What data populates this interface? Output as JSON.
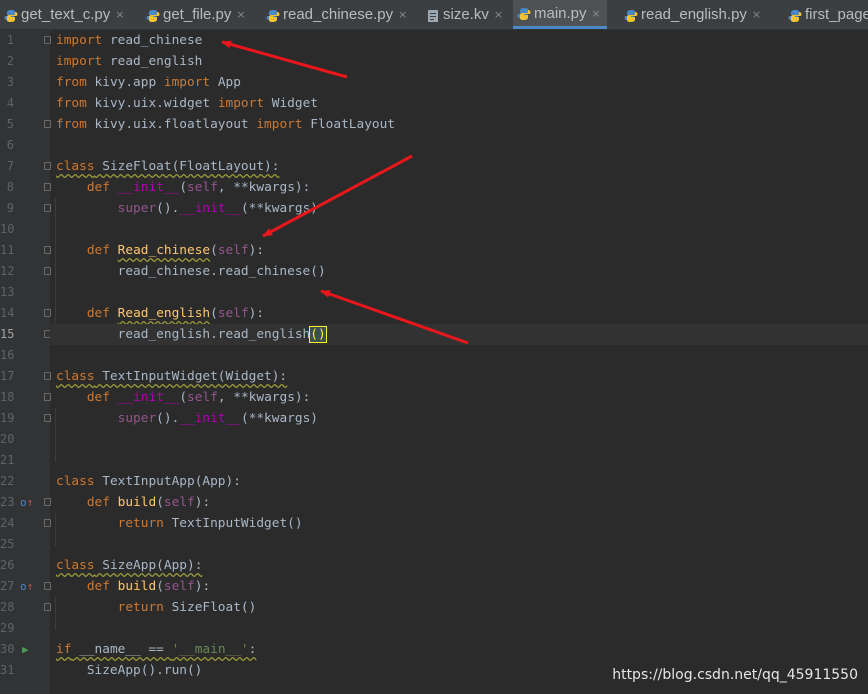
{
  "tabs": [
    {
      "label": "get_text_c.py",
      "close": "×",
      "active": false,
      "icon": "python-file-icon"
    },
    {
      "label": "get_file.py",
      "close": "×",
      "active": false,
      "icon": "python-file-icon"
    },
    {
      "label": "read_chinese.py",
      "close": "×",
      "active": false,
      "icon": "python-file-icon"
    },
    {
      "label": "size.kv",
      "close": "×",
      "active": false,
      "icon": "kv-file-icon"
    },
    {
      "label": "main.py",
      "close": "×",
      "active": true,
      "icon": "python-file-icon"
    },
    {
      "label": "read_english.py",
      "close": "×",
      "active": false,
      "icon": "python-file-icon"
    },
    {
      "label": "first_page",
      "close": "",
      "active": false,
      "icon": "python-file-icon"
    }
  ],
  "editor": {
    "current_line": 15,
    "lines": [
      {
        "n": "1",
        "tokens": [
          [
            "kw",
            "import"
          ],
          [
            "p",
            " read_chinese"
          ]
        ]
      },
      {
        "n": "2",
        "tokens": [
          [
            "kw",
            "import"
          ],
          [
            "p",
            " read_english"
          ]
        ]
      },
      {
        "n": "3",
        "tokens": [
          [
            "kw",
            "from"
          ],
          [
            "p",
            " kivy.app "
          ],
          [
            "kw",
            "import"
          ],
          [
            "p",
            " App"
          ]
        ]
      },
      {
        "n": "4",
        "tokens": [
          [
            "kw",
            "from"
          ],
          [
            "p",
            " kivy.uix.widget "
          ],
          [
            "kw",
            "import"
          ],
          [
            "p",
            " Widget"
          ]
        ]
      },
      {
        "n": "5",
        "tokens": [
          [
            "kw",
            "from"
          ],
          [
            "p",
            " kivy.uix.floatlayout "
          ],
          [
            "kw",
            "import"
          ],
          [
            "p",
            " FloatLayout"
          ]
        ]
      },
      {
        "n": "6",
        "tokens": []
      },
      {
        "n": "7",
        "tokens": [
          [
            "kw wv",
            "class"
          ],
          [
            "wv",
            " SizeFloat(FloatLayout):"
          ]
        ]
      },
      {
        "n": "8",
        "tokens": [
          [
            "p",
            "    "
          ],
          [
            "kw",
            "def"
          ],
          [
            "p",
            " "
          ],
          [
            "mg",
            "__init__"
          ],
          [
            "p",
            "("
          ],
          [
            "sf",
            "self"
          ],
          [
            "p",
            ", **kwargs):"
          ]
        ]
      },
      {
        "n": "9",
        "tokens": [
          [
            "p",
            "        "
          ],
          [
            "sf",
            "super"
          ],
          [
            "p",
            "()."
          ],
          [
            "mg",
            "__init__"
          ],
          [
            "p",
            "(**kwargs)"
          ]
        ]
      },
      {
        "n": "10",
        "tokens": []
      },
      {
        "n": "11",
        "tokens": [
          [
            "p",
            "    "
          ],
          [
            "kw",
            "def"
          ],
          [
            "p",
            " "
          ],
          [
            "fn wv",
            "Read_chinese"
          ],
          [
            "p",
            "("
          ],
          [
            "sf",
            "self"
          ],
          [
            "p",
            "):"
          ]
        ]
      },
      {
        "n": "12",
        "tokens": [
          [
            "p",
            "        read_chinese.read_chinese()"
          ]
        ]
      },
      {
        "n": "13",
        "tokens": []
      },
      {
        "n": "14",
        "tokens": [
          [
            "p",
            "    "
          ],
          [
            "kw",
            "def"
          ],
          [
            "p",
            " "
          ],
          [
            "fn wv",
            "Read_english"
          ],
          [
            "p",
            "("
          ],
          [
            "sf",
            "self"
          ],
          [
            "p",
            "):"
          ]
        ]
      },
      {
        "n": "15",
        "tokens": [
          [
            "p",
            "        read_english.read_english"
          ],
          [
            "br",
            "()"
          ]
        ]
      },
      {
        "n": "16",
        "tokens": []
      },
      {
        "n": "17",
        "tokens": [
          [
            "kw wv",
            "class"
          ],
          [
            "wv",
            " TextInputWidget(Widget):"
          ]
        ]
      },
      {
        "n": "18",
        "tokens": [
          [
            "p",
            "    "
          ],
          [
            "kw",
            "def"
          ],
          [
            "p",
            " "
          ],
          [
            "mg",
            "__init__"
          ],
          [
            "p",
            "("
          ],
          [
            "sf",
            "self"
          ],
          [
            "p",
            ", **kwargs):"
          ]
        ]
      },
      {
        "n": "19",
        "tokens": [
          [
            "p",
            "        "
          ],
          [
            "sf",
            "super"
          ],
          [
            "p",
            "()."
          ],
          [
            "mg",
            "__init__"
          ],
          [
            "p",
            "(**kwargs)"
          ]
        ]
      },
      {
        "n": "20",
        "tokens": []
      },
      {
        "n": "21",
        "tokens": []
      },
      {
        "n": "22",
        "tokens": [
          [
            "kw",
            "class"
          ],
          [
            "p",
            " TextInputApp(App):"
          ]
        ]
      },
      {
        "n": "23",
        "tokens": [
          [
            "p",
            "    "
          ],
          [
            "kw",
            "def"
          ],
          [
            "p",
            " "
          ],
          [
            "fn",
            "build"
          ],
          [
            "p",
            "("
          ],
          [
            "sf",
            "self"
          ],
          [
            "p",
            "):"
          ]
        ]
      },
      {
        "n": "24",
        "tokens": [
          [
            "p",
            "        "
          ],
          [
            "kw",
            "return"
          ],
          [
            "p",
            " TextInputWidget()"
          ]
        ]
      },
      {
        "n": "25",
        "tokens": []
      },
      {
        "n": "26",
        "tokens": [
          [
            "kw wv",
            "class"
          ],
          [
            "wv",
            " SizeApp(App):"
          ]
        ]
      },
      {
        "n": "27",
        "tokens": [
          [
            "p",
            "    "
          ],
          [
            "kw",
            "def"
          ],
          [
            "p",
            " "
          ],
          [
            "fn",
            "build"
          ],
          [
            "p",
            "("
          ],
          [
            "sf",
            "self"
          ],
          [
            "p",
            "):"
          ]
        ]
      },
      {
        "n": "28",
        "tokens": [
          [
            "p",
            "        "
          ],
          [
            "kw",
            "return"
          ],
          [
            "p",
            " SizeFloat()"
          ]
        ]
      },
      {
        "n": "29",
        "tokens": []
      },
      {
        "n": "30",
        "tokens": [
          [
            "kw wv",
            "if"
          ],
          [
            "wv",
            " __name__ == "
          ],
          [
            "st wv",
            "'__main__'"
          ],
          [
            "wv",
            ":"
          ]
        ]
      },
      {
        "n": "31",
        "tokens": [
          [
            "p",
            "    SizeApp().run()"
          ]
        ]
      }
    ]
  },
  "gutter_markers": {
    "override_lines": [
      23,
      27
    ],
    "run_lines": [
      30
    ],
    "fold_lines": [
      1,
      5,
      7,
      8,
      9,
      11,
      12,
      14,
      15,
      17,
      18,
      19,
      23,
      24,
      27,
      28
    ]
  },
  "annotations": {
    "arrow_color": "#e8171c",
    "count": 3
  },
  "colors": {
    "editor_bg": "#2b2b2b",
    "keyword": "#cc7832",
    "self": "#94558d",
    "function": "#ffc66d",
    "magic": "#b200b2",
    "string": "#6a8759",
    "text": "#a9b7c6"
  },
  "watermark": "https://blog.csdn.net/qq_45911550"
}
